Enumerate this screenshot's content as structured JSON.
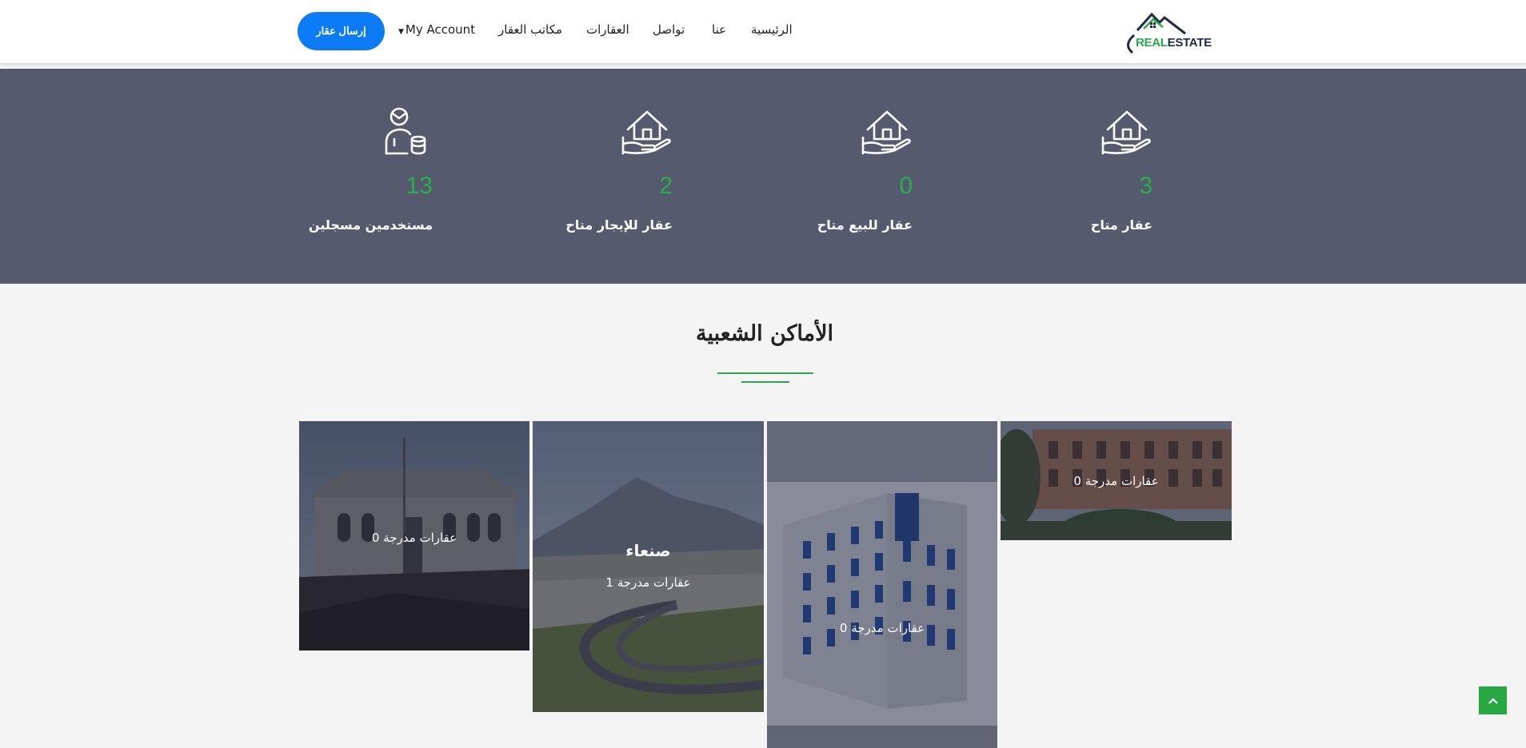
{
  "header": {
    "logo": {
      "part1": "REAL",
      "part2": "ESTATE"
    },
    "nav": [
      {
        "label": "الرئيسية"
      },
      {
        "label": "عنا"
      },
      {
        "label": "تواصل"
      },
      {
        "label": "العقارات"
      },
      {
        "label": "مكاتب العقار"
      },
      {
        "label": "My Account"
      }
    ],
    "submit_label": "إرسال عقار"
  },
  "stats": [
    {
      "value": "3",
      "label": "عقار متاح",
      "icon": "house-hand-icon"
    },
    {
      "value": "0",
      "label": "عقار للبيع متاح",
      "icon": "house-hand-icon"
    },
    {
      "value": "2",
      "label": "عقار للإيجار متاح",
      "icon": "house-hand-icon"
    },
    {
      "value": "13",
      "label": "مستخدمين مسجلين",
      "icon": "user-money-icon"
    }
  ],
  "section": {
    "title": "الأماكن الشعبية"
  },
  "places": [
    {
      "name": "",
      "count": "0 عقارات مدرجة"
    },
    {
      "name": "",
      "count": "0 عقارات مدرجة"
    },
    {
      "name": "صنعاء",
      "count": "1 عقارات مدرجة"
    },
    {
      "name": "",
      "count": "0 عقارات مدرجة"
    }
  ],
  "colors": {
    "accent": "#0d7bf5",
    "green": "#27b04a",
    "band": "#555a6e"
  }
}
